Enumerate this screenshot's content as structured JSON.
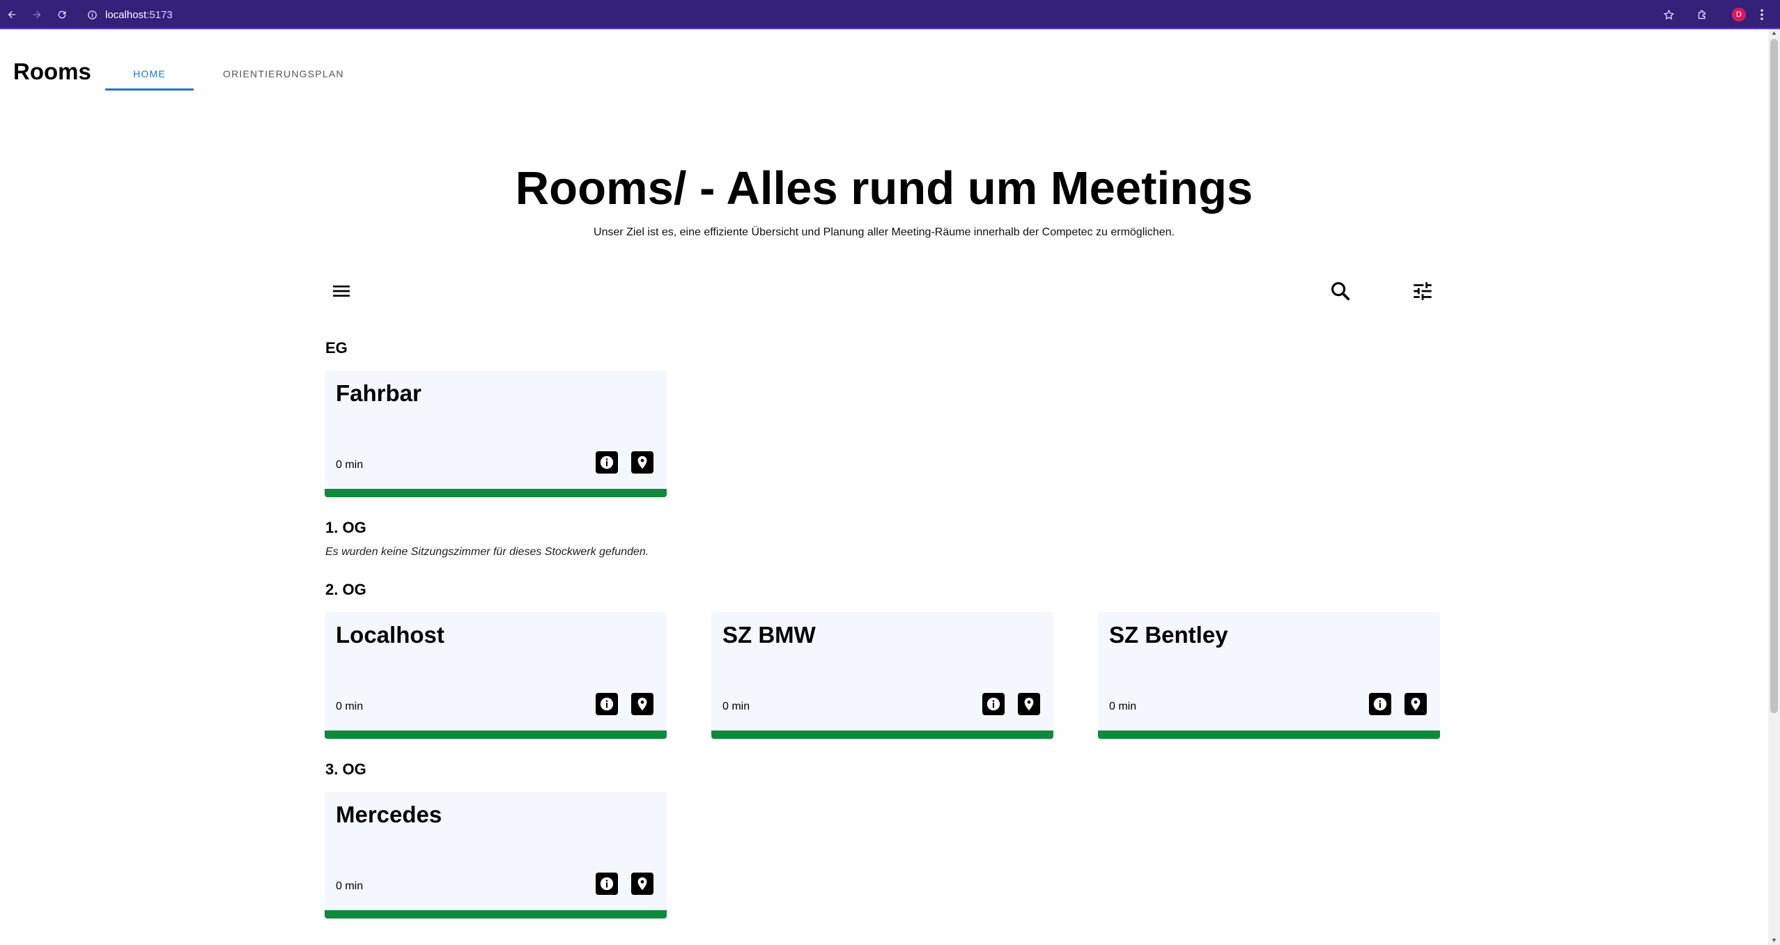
{
  "browser": {
    "url_host": "localhost",
    "url_port": ":5173",
    "profile_initial": "D"
  },
  "app": {
    "title": "Rooms",
    "tabs": [
      {
        "label": "HOME",
        "active": true
      },
      {
        "label": "ORIENTIERUNGSPLAN",
        "active": false
      }
    ]
  },
  "hero": {
    "title": "Rooms/ - Alles rund um Meetings",
    "subtitle": "Unser Ziel ist es, eine effiziente Übersicht und Planung aller Meeting-Räume innerhalb der Competec zu ermöglichen."
  },
  "toolbar": {
    "icons": [
      "menu-icon",
      "search-icon",
      "tune-icon"
    ]
  },
  "floors": [
    {
      "name": "EG",
      "rooms": [
        {
          "name": "Fahrbar",
          "time": "0 min"
        }
      ]
    },
    {
      "name": "1. OG",
      "empty_text": "Es wurden keine Sitzungszimmer für dieses Stockwerk gefunden.",
      "rooms": []
    },
    {
      "name": "2. OG",
      "rooms": [
        {
          "name": "Localhost",
          "time": "0 min"
        },
        {
          "name": "SZ BMW",
          "time": "0 min"
        },
        {
          "name": "SZ Bentley",
          "time": "0 min"
        }
      ]
    },
    {
      "name": "3. OG",
      "rooms": [
        {
          "name": "Mercedes",
          "time": "0 min"
        }
      ]
    }
  ],
  "colors": {
    "browser_bar": "#35207a",
    "tab_active": "#1976d2",
    "card_bg": "#f4f7fd",
    "availability_bar": "#0f8a3c"
  }
}
